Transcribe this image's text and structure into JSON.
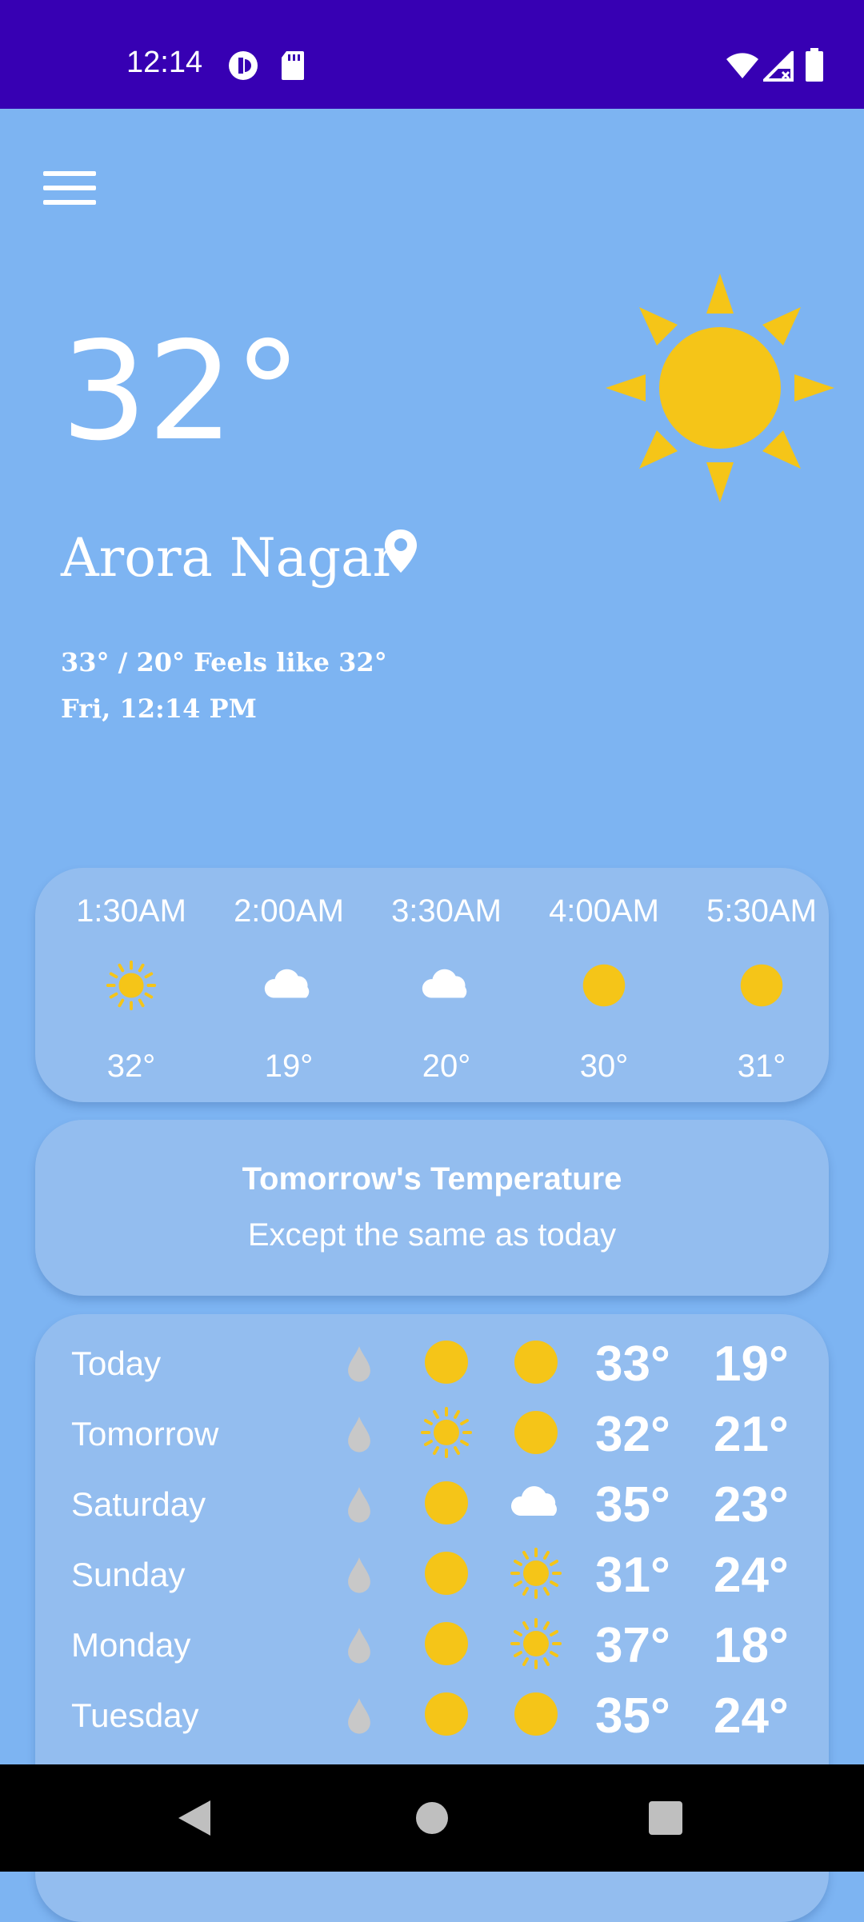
{
  "status_bar": {
    "time": "12:14",
    "icons": [
      "vpn-icon",
      "sd-card-icon",
      "wifi-icon",
      "signal-icon",
      "battery-icon"
    ]
  },
  "toolbar": {
    "menu_icon": "hamburger-menu-icon"
  },
  "current": {
    "temperature": "32°",
    "location": "Arora Nagar",
    "summary": "33° / 20° Feels like 32°",
    "datetime": "Fri, 12:14 PM",
    "icon": "sun-icon"
  },
  "hourly": [
    {
      "time": "1:30AM",
      "icon": "sun-rays-icon",
      "temp": "32°"
    },
    {
      "time": "2:00AM",
      "icon": "cloud-icon",
      "temp": "19°"
    },
    {
      "time": "3:30AM",
      "icon": "cloud-icon",
      "temp": "20°"
    },
    {
      "time": "4:00AM",
      "icon": "sun-disc-icon",
      "temp": "30°"
    },
    {
      "time": "5:30AM",
      "icon": "sun-disc-icon",
      "temp": "31°"
    }
  ],
  "tomorrow": {
    "title": "Tomorrow's Temperature",
    "text": "Except the same as today"
  },
  "daily": [
    {
      "day": "Today",
      "icon1": "sun-disc-icon",
      "icon2": "sun-disc-icon",
      "high": "33°",
      "low": "19°"
    },
    {
      "day": "Tomorrow",
      "icon1": "sun-rays-icon",
      "icon2": "sun-disc-icon",
      "high": "32°",
      "low": "21°"
    },
    {
      "day": "Saturday",
      "icon1": "sun-disc-icon",
      "icon2": "cloud-icon",
      "high": "35°",
      "low": "23°"
    },
    {
      "day": "Sunday",
      "icon1": "sun-disc-icon",
      "icon2": "sun-rays-icon",
      "high": "31°",
      "low": "24°"
    },
    {
      "day": "Monday",
      "icon1": "sun-disc-icon",
      "icon2": "sun-rays-icon",
      "high": "37°",
      "low": "18°"
    },
    {
      "day": "Tuesday",
      "icon1": "sun-disc-icon",
      "icon2": "sun-disc-icon",
      "high": "35°",
      "low": "24°"
    }
  ],
  "nav_bar": {
    "buttons": [
      "back-icon",
      "home-icon",
      "recents-icon"
    ]
  },
  "colors": {
    "status_bar": "#3700b3",
    "background": "#7db4f2",
    "card": "#93bdef",
    "sun": "#f5c518",
    "drop": "#c8c8c8"
  }
}
